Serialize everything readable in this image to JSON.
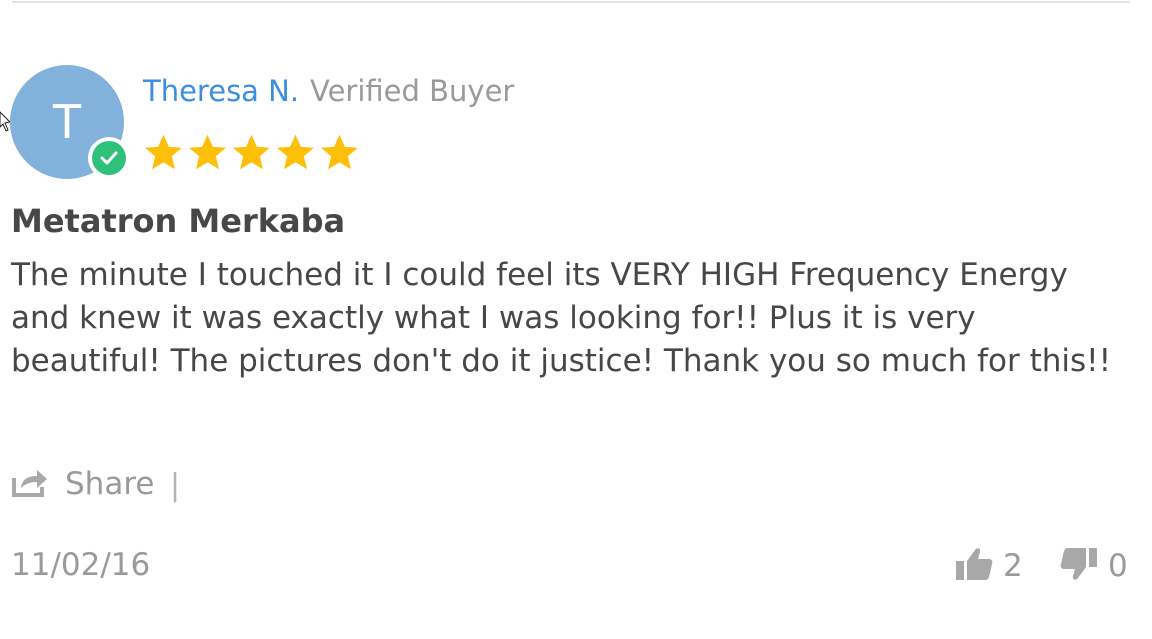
{
  "review": {
    "reviewer_name": "Theresa N.",
    "verified_badge": "Verified Buyer",
    "avatar_initial": "T",
    "rating": 5,
    "rating_max": 5,
    "title": "Metatron Merkaba",
    "body": "The minute I touched it I could feel its VERY HIGH Frequency Energy and knew it was exactly what I was looking for!! Plus it is very beautiful! The pictures don't do it justice! Thank you so much for this!!",
    "date": "11/02/16"
  },
  "actions": {
    "share_label": "Share",
    "separator": "|",
    "thumbs_up_count": "2",
    "thumbs_down_count": "0"
  },
  "icons": {
    "share": "share-icon",
    "thumbs_up": "thumbs-up-icon",
    "thumbs_down": "thumbs-down-icon",
    "verified": "verified-check-icon",
    "star": "star-icon"
  },
  "colors": {
    "name": "#3c8ee0",
    "avatar": "#82b2dc",
    "verified": "#2fc07b",
    "star": "#fdbf0a",
    "text": "#474747",
    "muted": "#9a9a9a"
  }
}
